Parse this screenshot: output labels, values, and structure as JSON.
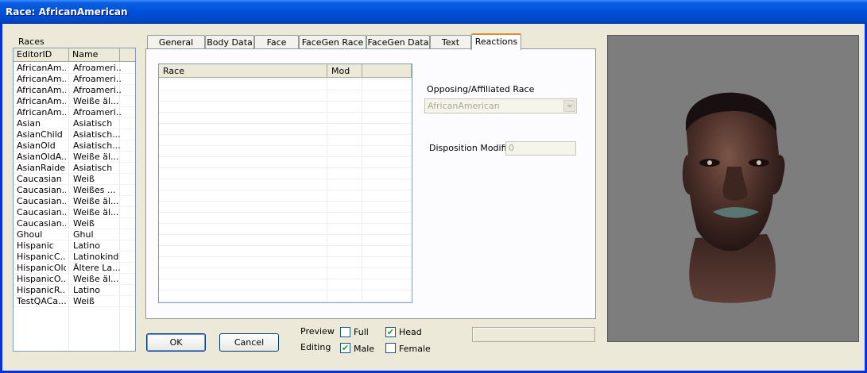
{
  "window": {
    "title": "Race: AfricanAmerican"
  },
  "races": {
    "label": "Races",
    "columns": [
      "EditorID",
      "Name"
    ],
    "rows": [
      [
        "AfricanAm...",
        "Afroameri..."
      ],
      [
        "AfricanAm...",
        "Afroameri..."
      ],
      [
        "AfricanAm...",
        "Afroameri..."
      ],
      [
        "AfricanAm...",
        "Weiße äl..."
      ],
      [
        "AfricanAm...",
        "Afroameri..."
      ],
      [
        "Asian",
        "Asiatisch"
      ],
      [
        "AsianChild",
        "Asiatisch..."
      ],
      [
        "AsianOld",
        "Asiatisch..."
      ],
      [
        "AsianOldA...",
        "Weiße äl..."
      ],
      [
        "AsianRaider",
        "Asiatisch"
      ],
      [
        "Caucasian",
        "Weiß"
      ],
      [
        "Caucasian...",
        "Weißes ..."
      ],
      [
        "Caucasian...",
        "Weiße äl..."
      ],
      [
        "Caucasian...",
        "Weiße äl..."
      ],
      [
        "Caucasian...",
        "Weiß"
      ],
      [
        "Ghoul",
        "Ghul"
      ],
      [
        "Hispanic",
        "Latino"
      ],
      [
        "HispanicC...",
        "Latinokind"
      ],
      [
        "HispanicOld",
        "Ältere La..."
      ],
      [
        "HispanicO...",
        "Weiße äl..."
      ],
      [
        "HispanicR...",
        "Latino"
      ],
      [
        "TestQACa...",
        "Weiß"
      ]
    ]
  },
  "tabs": [
    "General Data",
    "Body Data",
    "Face Data",
    "FaceGen Race",
    "FaceGen Data",
    "Text Data",
    "Reactions"
  ],
  "active_tab": "Reactions",
  "reactions": {
    "columns": [
      "Race",
      "Mod"
    ],
    "opposing_label": "Opposing/Affiliated Race",
    "opposing_value": "AfricanAmerican",
    "disposition_label": "Disposition Modifier",
    "disposition_value": "0"
  },
  "buttons": {
    "ok": "OK",
    "cancel": "Cancel"
  },
  "options": {
    "preview_label": "Preview",
    "editing_label": "Editing",
    "full": {
      "label": "Full",
      "checked": false
    },
    "head": {
      "label": "Head",
      "checked": true
    },
    "male": {
      "label": "Male",
      "checked": true
    },
    "female": {
      "label": "Female",
      "checked": false
    }
  },
  "colors": {
    "titlebar": "#0054e3",
    "dialog_bg": "#ece9d8",
    "preview_bg": "#7d7d7d",
    "tab_highlight": "#e68b2c"
  },
  "icons": {
    "checkbox_mark": "checkmark-icon",
    "combo_arrow": "chevron-down-icon"
  }
}
